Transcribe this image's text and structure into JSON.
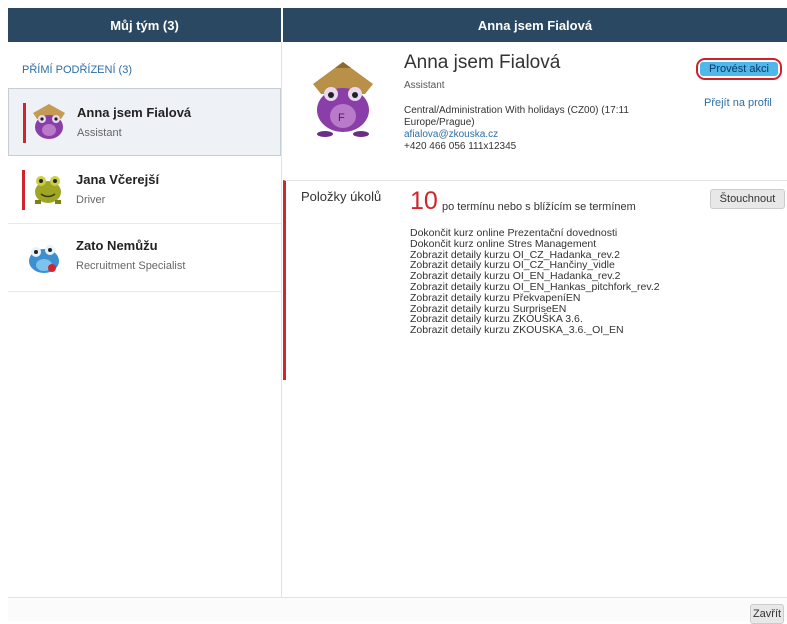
{
  "header": {
    "left_title": "Můj tým (3)",
    "right_title": "Anna jsem Fialová"
  },
  "sidebar": {
    "section_label": "PŘÍMÍ PODŘÍZENÍ (3)",
    "members": [
      {
        "name": "Anna jsem Fialová",
        "role": "Assistant",
        "avatar": "purple-frog-avatar"
      },
      {
        "name": "Jana Včerejší",
        "role": "Driver",
        "avatar": "green-frog-avatar"
      },
      {
        "name": "Zato Nemůžu",
        "role": "Recruitment Specialist",
        "avatar": "blue-creature-avatar"
      }
    ]
  },
  "profile": {
    "name": "Anna jsem Fialová",
    "title": "Assistant",
    "org": "Central/Administration With holidays (CZ00) (17:11",
    "timezone": "Europe/Prague)",
    "email": "afialova@zkouska.cz",
    "phone": "+420 466 056 111x12345",
    "action_button": "Provést akci",
    "profile_link": "Přejít na profil"
  },
  "tasks": {
    "label": "Položky úkolů",
    "count": "10",
    "count_text": "po termínu nebo s blížícím se termínem",
    "nudge_button": "Štouchnout",
    "items": [
      "Dokončit kurz online Prezentační dovednosti",
      "Dokončit kurz online Stres Management",
      "Zobrazit detaily kurzu OI_CZ_Hadanka_rev.2",
      "Zobrazit detaily kurzu OI_CZ_Hančiny_vidle",
      "Zobrazit detaily kurzu OI_EN_Hadanka_rev.2",
      "Zobrazit detaily kurzu OI_EN_Hankas_pitchfork_rev.2",
      "Zobrazit detaily kurzu PřekvapeníEN",
      "Zobrazit detaily kurzu SurpriseEN",
      "Zobrazit detaily kurzu ZKOUŠKA 3.6.",
      "Zobrazit detaily kurzu ZKOUSKA_3.6._OI_EN"
    ]
  },
  "footer": {
    "close_button": "Zavřít"
  },
  "colors": {
    "header_bg": "#2b4862",
    "accent_red": "#d0252c",
    "link_blue": "#2c6ea6",
    "action_blue": "#4fb7ea"
  }
}
